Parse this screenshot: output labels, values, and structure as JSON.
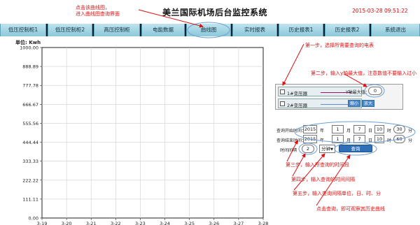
{
  "header": {
    "title": "美兰国际机场后台监控系统",
    "datetime": "2015-03-28 09:51:22",
    "annotation_line1": "点击该曲线图，",
    "annotation_line2": "进入曲线图查询界面"
  },
  "nav": [
    {
      "label": "低压控制柜1"
    },
    {
      "label": "低压控制柜2"
    },
    {
      "label": "高压控制柜"
    },
    {
      "label": "电能数据"
    },
    {
      "label": "曲线图"
    },
    {
      "label": "实时报表"
    },
    {
      "label": "历史报表1"
    },
    {
      "label": "历史报表2"
    },
    {
      "label": "系统退出"
    }
  ],
  "chart_data": {
    "type": "line",
    "ylabel": "单位: Kwh",
    "ylim": [
      0,
      1000
    ],
    "yticks": [
      "1000.00",
      "888.89",
      "777.78",
      "666.67",
      "555.56",
      "444.44",
      "333.33",
      "222.22",
      "111.11",
      "0.00"
    ],
    "categories": [
      "3-19",
      "3-20",
      "3-21",
      "3-22",
      "3-23",
      "3-24",
      "3-25",
      "3-26",
      "3-27",
      "3-28"
    ],
    "series": [],
    "grid": true
  },
  "transformers": [
    {
      "label": "1#变压器",
      "color": "#a0106a"
    },
    {
      "label": "2#变压器",
      "color": "#6a8ad8"
    }
  ],
  "y_axis_max": {
    "label": "Y轴最大值：",
    "value": "0"
  },
  "zoom": {
    "shrink": "缩小",
    "enlarge": "放大"
  },
  "query_start": {
    "label": "查询开始时间：",
    "year": "2015",
    "month": "1",
    "day": "7",
    "hour": "10",
    "minute": "30"
  },
  "query_end": {
    "label": "查询结束时间：",
    "year": "2015",
    "month": "1",
    "day": "7",
    "hour": "10",
    "minute": "60"
  },
  "time_units": {
    "year": "年",
    "month": "月",
    "day": "日",
    "hour": "时",
    "minute": "分"
  },
  "interval": {
    "label": "时间间隔",
    "value": "2",
    "unit": "分钟"
  },
  "query_button": "查询",
  "annotations": {
    "step1": "第一步，选择所需要查询的电表",
    "step2": "第二步，输入y轴最大值，注意数值不要输入过小",
    "step3": "第三步，输入所查询的时间段",
    "step4": "第四步，输入查询的时间间隔",
    "step5": "第五步，输入查询间隔单位，日、时、分",
    "step6": "点击查询，即可观察其历史曲线"
  }
}
